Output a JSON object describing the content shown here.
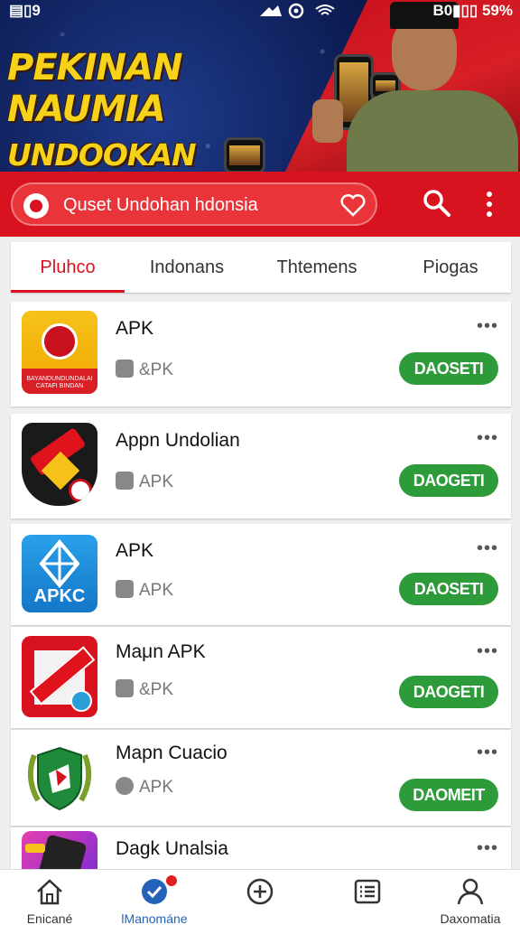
{
  "status_bar": {
    "left": "▤▯9",
    "right": "B0▮▯▯ 59%"
  },
  "banner": {
    "line1": "PEKINAN NAUMIA",
    "line2": "UNDOOKAN IDANESIA"
  },
  "search": {
    "placeholder": "Quset Undohan hdonsia"
  },
  "tabs": [
    {
      "label": "Pluhco",
      "active": true
    },
    {
      "label": "Indonans",
      "active": false
    },
    {
      "label": "Thtemens",
      "active": false
    },
    {
      "label": "Piogas",
      "active": false
    }
  ],
  "apps": [
    {
      "name": "APK",
      "sub": "&PK",
      "button": "DAOSETI",
      "icon_caption": "BAYANDUNDUNDALAI CATAFI BINDAN"
    },
    {
      "name": "Appn Undolian",
      "sub": "APK",
      "button": "DAOGETI",
      "icon_caption": ""
    },
    {
      "name": "APK",
      "sub": "APK",
      "button": "DAOSETI",
      "icon_caption": "APKC"
    },
    {
      "name": "Maμn APK",
      "sub": "&PK",
      "button": "DAOGETI",
      "icon_caption": ""
    },
    {
      "name": "Mapn Cuacio",
      "sub": "APK",
      "button": "DAOMEIT",
      "icon_caption": ""
    },
    {
      "name": "Dagk Unalsia",
      "sub": "",
      "button": "",
      "icon_caption": ""
    }
  ],
  "more_label": "•••",
  "bottom_nav": [
    {
      "label": "Enicané",
      "icon": "home-icon",
      "active": false
    },
    {
      "label": "lManománe",
      "icon": "check-circle-icon",
      "active": true
    },
    {
      "label": "",
      "icon": "add-circle-icon",
      "active": false
    },
    {
      "label": "",
      "icon": "list-icon",
      "active": false
    },
    {
      "label": "Daxomatia",
      "icon": "profile-icon",
      "active": false
    }
  ],
  "colors": {
    "brand_red": "#d8121f",
    "button_green": "#2e9b3a",
    "active_blue": "#2563b8"
  }
}
